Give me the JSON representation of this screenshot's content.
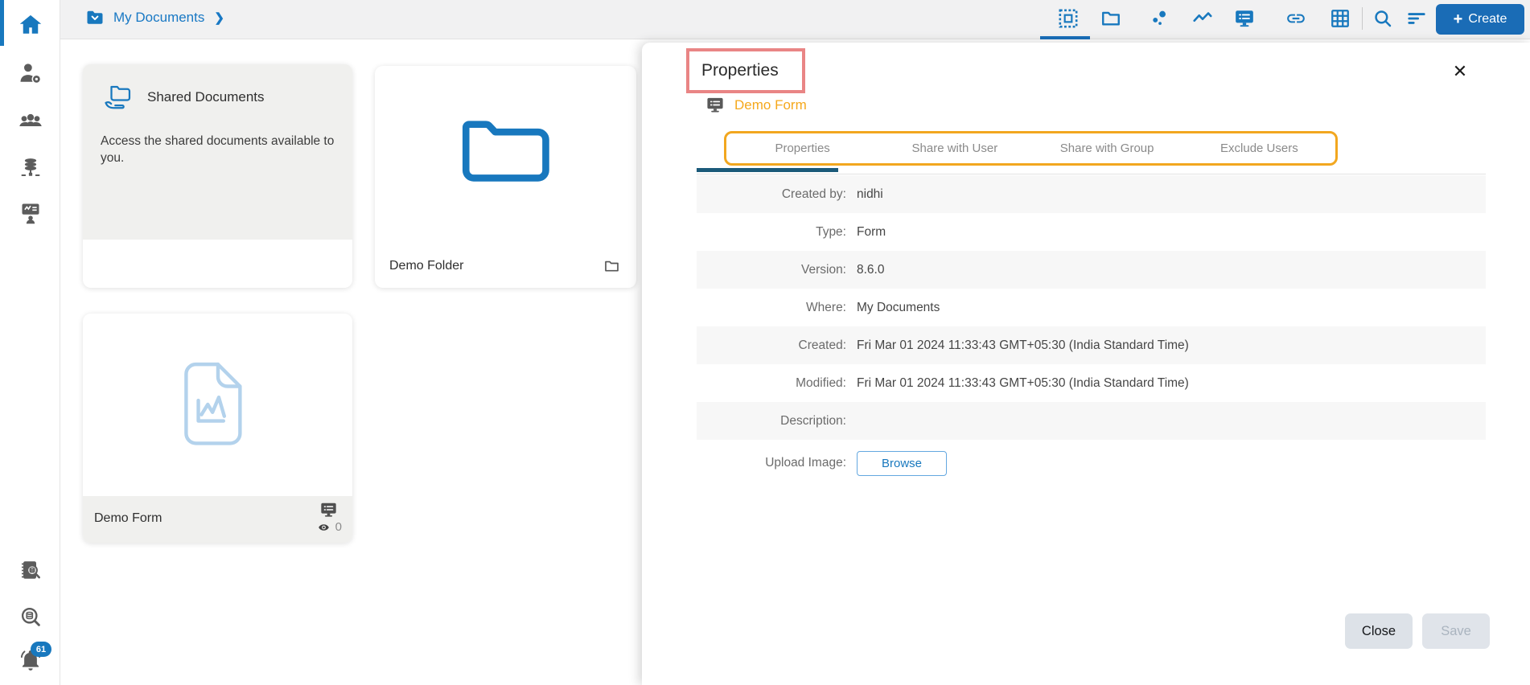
{
  "topbar": {
    "breadcrumb": "My Documents",
    "breadcrumb_chevron": "❯",
    "create_plus": "+",
    "create_button": "Create"
  },
  "sidebar": {
    "notification_count": "61"
  },
  "cards": {
    "shared": {
      "title": "Shared Documents",
      "description": "Access the shared documents available to you."
    },
    "folder": {
      "label": "Demo Folder"
    },
    "form": {
      "label": "Demo Form",
      "view_count": "0"
    }
  },
  "panel": {
    "title": "Properties",
    "item_name": "Demo Form",
    "close_icon": "✕",
    "tabs": [
      "Properties",
      "Share with User",
      "Share with Group",
      "Exclude Users"
    ],
    "rows": [
      {
        "label": "Created by:",
        "value": "nidhi"
      },
      {
        "label": "Type:",
        "value": "Form"
      },
      {
        "label": "Version:",
        "value": "8.6.0"
      },
      {
        "label": "Where:",
        "value": "My Documents"
      },
      {
        "label": "Created:",
        "value": "Fri Mar 01 2024 11:33:43 GMT+05:30 (India Standard Time)"
      },
      {
        "label": "Modified:",
        "value": "Fri Mar 01 2024 11:33:43 GMT+05:30 (India Standard Time)"
      },
      {
        "label": "Description:",
        "value": ""
      }
    ],
    "upload_label": "Upload Image:",
    "browse_button": "Browse",
    "close_button": "Close",
    "save_button": "Save"
  },
  "colors": {
    "accent_blue": "#1878be",
    "brand_orange": "#f5a81c",
    "annotation_red": "#e98585",
    "tab_underline": "#1b5a7a"
  }
}
